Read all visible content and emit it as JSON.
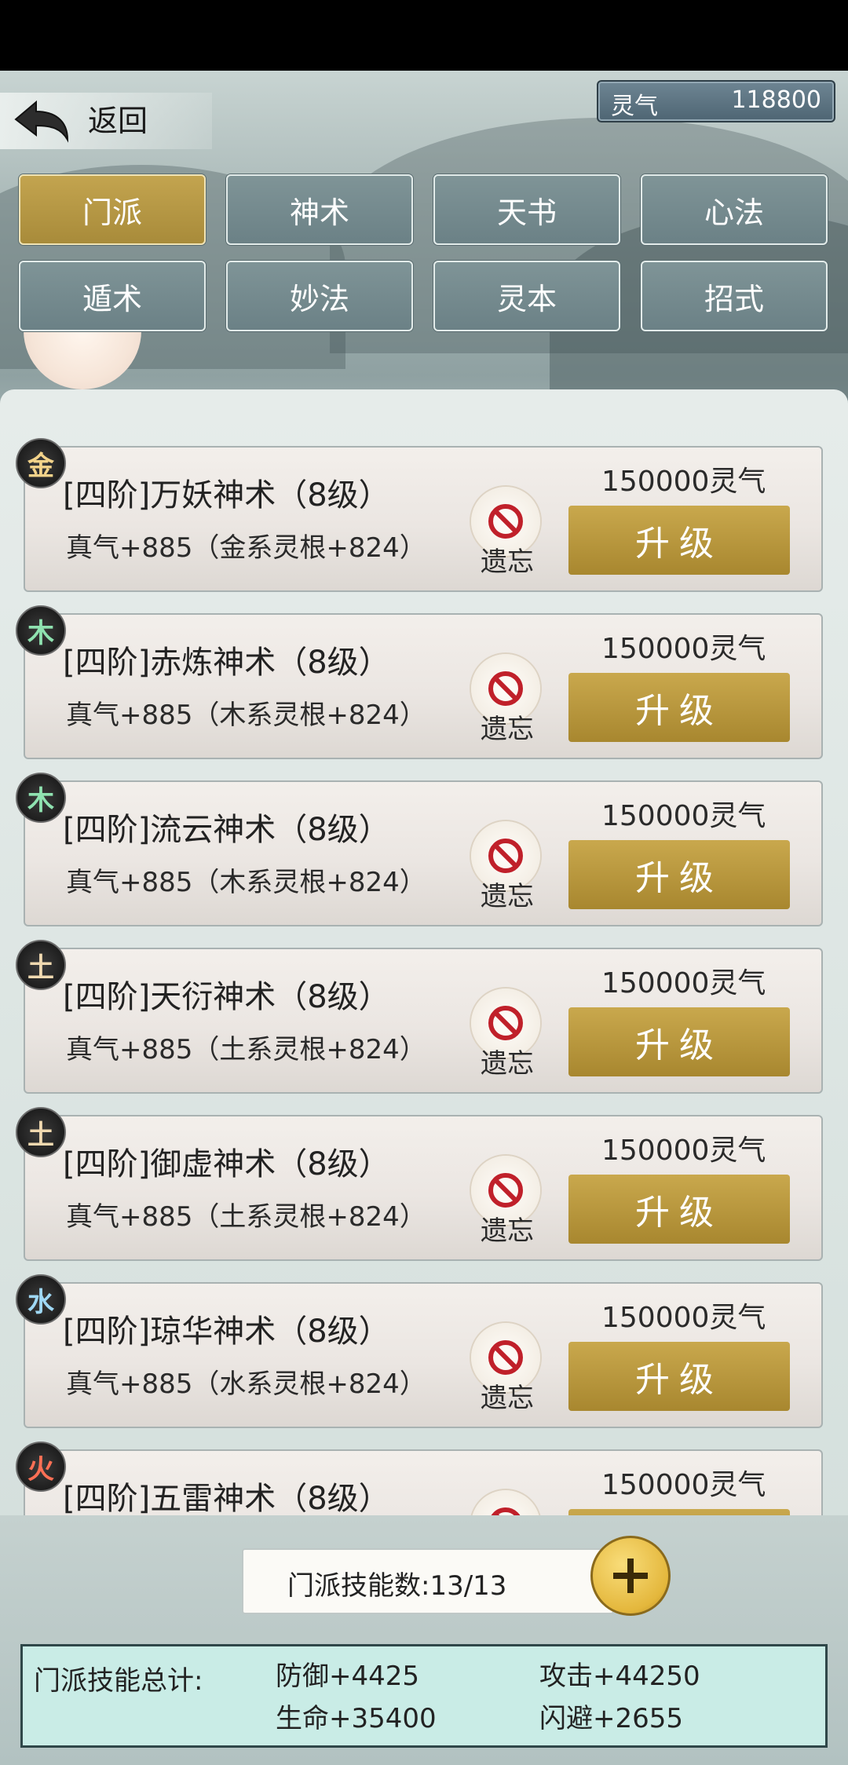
{
  "header": {
    "back_label": "返回",
    "currency_name": "灵气",
    "currency_value": "118800"
  },
  "tabs": [
    {
      "label": "门派",
      "active": true
    },
    {
      "label": "神术",
      "active": false
    },
    {
      "label": "天书",
      "active": false
    },
    {
      "label": "心法",
      "active": false
    },
    {
      "label": "遁术",
      "active": false
    },
    {
      "label": "妙法",
      "active": false
    },
    {
      "label": "灵本",
      "active": false
    },
    {
      "label": "招式",
      "active": false
    }
  ],
  "skills": [
    {
      "element": "金",
      "name": "[四阶]万妖神术（8级）",
      "desc": "真气+885（金系灵根+824）",
      "forget": "遗忘",
      "cost": "150000灵气",
      "upgrade": "升级"
    },
    {
      "element": "木",
      "name": "[四阶]赤炼神术（8级）",
      "desc": "真气+885（木系灵根+824）",
      "forget": "遗忘",
      "cost": "150000灵气",
      "upgrade": "升级"
    },
    {
      "element": "木",
      "name": "[四阶]流云神术（8级）",
      "desc": "真气+885（木系灵根+824）",
      "forget": "遗忘",
      "cost": "150000灵气",
      "upgrade": "升级"
    },
    {
      "element": "土",
      "name": "[四阶]天衍神术（8级）",
      "desc": "真气+885（土系灵根+824）",
      "forget": "遗忘",
      "cost": "150000灵气",
      "upgrade": "升级"
    },
    {
      "element": "土",
      "name": "[四阶]御虚神术（8级）",
      "desc": "真气+885（土系灵根+824）",
      "forget": "遗忘",
      "cost": "150000灵气",
      "upgrade": "升级"
    },
    {
      "element": "水",
      "name": "[四阶]琼华神术（8级）",
      "desc": "真气+885（水系灵根+824）",
      "forget": "遗忘",
      "cost": "150000灵气",
      "upgrade": "升级"
    },
    {
      "element": "火",
      "name": "[四阶]五雷神术（8级）",
      "cost": "150000灵气"
    }
  ],
  "footer": {
    "skill_count": "门派技能数:13/13",
    "summary_label": "门派技能总计:",
    "stats": [
      "防御+4425",
      "攻击+44250",
      "生命+35400",
      "闪避+2655"
    ]
  },
  "colors": {
    "accent_gold": "#b8973f",
    "tab_gray": "#768b8f",
    "forget_red": "#c0202a"
  }
}
